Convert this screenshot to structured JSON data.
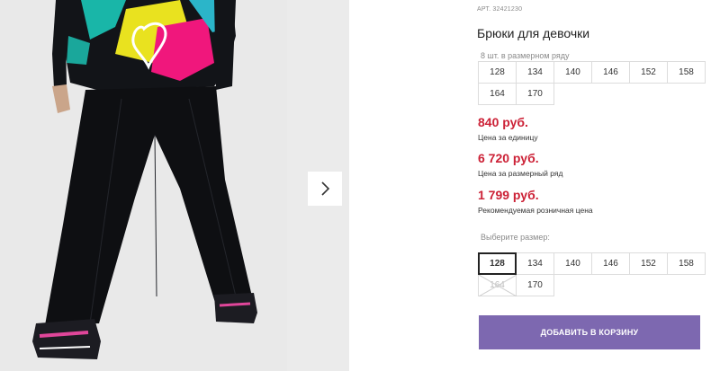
{
  "product": {
    "article": "АРТ. 32421230",
    "title": "Брюки для девочки"
  },
  "pack": {
    "label": "8 шт. в размерном ряду",
    "sizes": [
      "128",
      "134",
      "140",
      "146",
      "152",
      "158",
      "164",
      "170"
    ]
  },
  "prices": [
    {
      "value": "840 руб.",
      "note": "Цена за единицу"
    },
    {
      "value": "6 720 руб.",
      "note": "Цена за размерный ряд"
    },
    {
      "value": "1 799 руб.",
      "note": "Рекомендуемая розничная цена"
    }
  ],
  "size_select": {
    "label": "Выберите размер:",
    "sizes": [
      {
        "label": "128",
        "state": "selected"
      },
      {
        "label": "134",
        "state": "available"
      },
      {
        "label": "140",
        "state": "available"
      },
      {
        "label": "146",
        "state": "available"
      },
      {
        "label": "152",
        "state": "available"
      },
      {
        "label": "158",
        "state": "available"
      },
      {
        "label": "164",
        "state": "unavailable"
      },
      {
        "label": "170",
        "state": "available"
      }
    ]
  },
  "cart_button": {
    "label": "ДОБАВИТЬ В КОРЗИНУ"
  },
  "gallery": {
    "next_icon": "chevron-right-icon"
  },
  "colors": {
    "price": "#cc2136",
    "button": "#7d68b0"
  }
}
